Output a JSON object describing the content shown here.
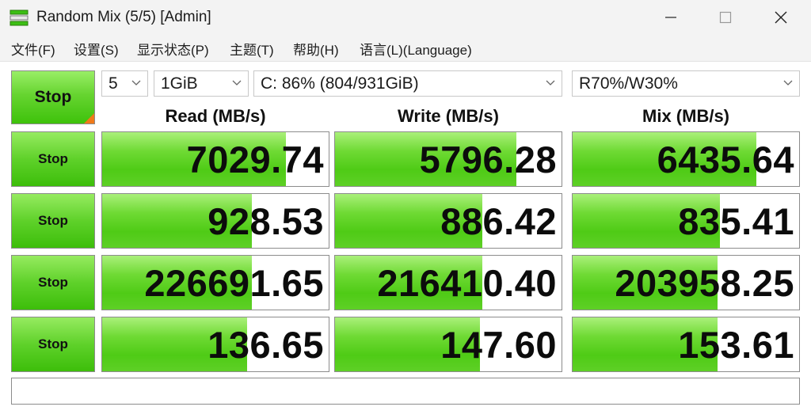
{
  "window": {
    "title": "Random Mix (5/5) [Admin]"
  },
  "menu": [
    "文件(F)",
    "设置(S)",
    "显示状态(P)",
    "主题(T)",
    "帮助(H)",
    "语言(L)(Language)"
  ],
  "controls": {
    "start_label": "Stop",
    "count": "5",
    "size": "1GiB",
    "drive": "C: 86% (804/931GiB)",
    "mix_ratio": "R70%/W30%"
  },
  "headers": {
    "read": "Read (MB/s)",
    "write": "Write (MB/s)",
    "mix": "Mix (MB/s)"
  },
  "rows": [
    {
      "button": "Stop",
      "read": "7029.74",
      "write": "5796.28",
      "mix": "6435.64",
      "read_fill": 0.81,
      "write_fill": 0.8,
      "mix_fill": 0.81
    },
    {
      "button": "Stop",
      "read": "928.53",
      "write": "886.42",
      "mix": "835.41",
      "read_fill": 0.66,
      "write_fill": 0.65,
      "mix_fill": 0.65
    },
    {
      "button": "Stop",
      "read": "226691.65",
      "write": "216410.40",
      "mix": "203958.25",
      "read_fill": 0.66,
      "write_fill": 0.65,
      "mix_fill": 0.64
    },
    {
      "button": "Stop",
      "read": "136.65",
      "write": "147.60",
      "mix": "153.61",
      "read_fill": 0.64,
      "write_fill": 0.64,
      "mix_fill": 0.64
    }
  ],
  "comment": "",
  "colors": {
    "bar_green": "#5fd12a",
    "corner_orange": "#f07a1a"
  }
}
